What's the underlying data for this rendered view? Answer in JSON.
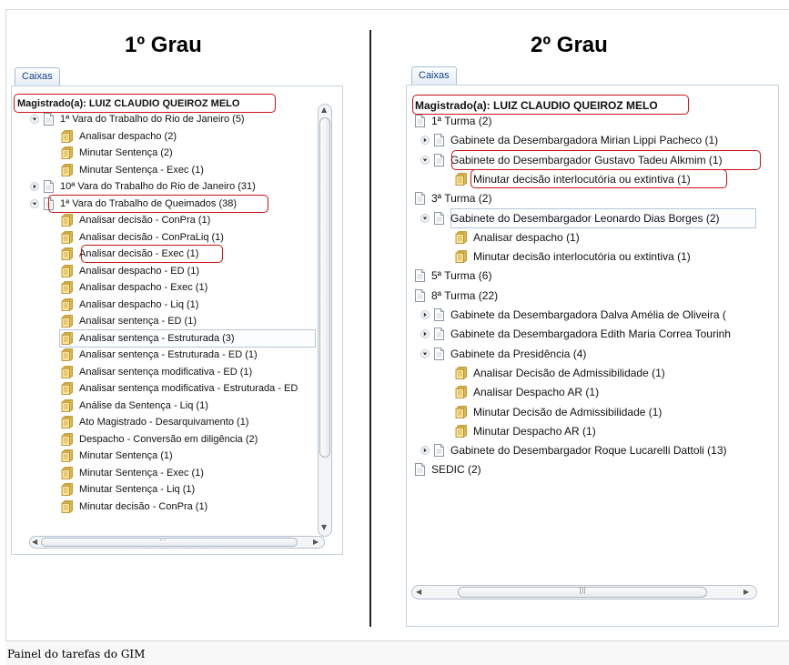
{
  "caption": "Painel do tarefas do GIM",
  "left": {
    "heading": "1º Grau",
    "tab": "Caixas",
    "magistrado": "Magistrado(a): LUIZ CLAUDIO QUEIROZ MELO",
    "nodes": [
      {
        "label": "1ª Vara do Trabalho do Rio de Janeiro (5)",
        "type": "doc",
        "toggle": "expanded"
      },
      {
        "label": "Analisar despacho (2)",
        "type": "folder"
      },
      {
        "label": "Minutar Sentença (2)",
        "type": "folder"
      },
      {
        "label": "Minutar Sentença - Exec (1)",
        "type": "folder"
      },
      {
        "label": "10ª Vara do Trabalho do Rio de Janeiro (31)",
        "type": "doc",
        "toggle": "collapsed"
      },
      {
        "label": "1ª Vara do Trabalho de Queimados (38)",
        "type": "doc",
        "toggle": "expanded"
      },
      {
        "label": "Analisar decisão - ConPra (1)",
        "type": "folder"
      },
      {
        "label": "Analisar decisão - ConPraLiq (1)",
        "type": "folder"
      },
      {
        "label": "Analisar decisão - Exec (1)",
        "type": "folder"
      },
      {
        "label": "Analisar despacho - ED (1)",
        "type": "folder"
      },
      {
        "label": "Analisar despacho - Exec (1)",
        "type": "folder"
      },
      {
        "label": "Analisar despacho - Liq (1)",
        "type": "folder"
      },
      {
        "label": "Analisar sentença - ED (1)",
        "type": "folder"
      },
      {
        "label": "Analisar sentença - Estruturada (3)",
        "type": "folder"
      },
      {
        "label": "Analisar sentença - Estruturada - ED (1)",
        "type": "folder"
      },
      {
        "label": "Analisar sentença modificativa - ED (1)",
        "type": "folder"
      },
      {
        "label": "Analisar sentença modificativa - Estruturada - ED",
        "type": "folder"
      },
      {
        "label": "Análise da Sentença - Liq (1)",
        "type": "folder"
      },
      {
        "label": "Ato Magistrado - Desarquivamento (1)",
        "type": "folder"
      },
      {
        "label": "Despacho - Conversão em diligência (2)",
        "type": "folder"
      },
      {
        "label": "Minutar Sentença (1)",
        "type": "folder"
      },
      {
        "label": "Minutar Sentença - Exec (1)",
        "type": "folder"
      },
      {
        "label": "Minutar Sentença - Liq (1)",
        "type": "folder"
      },
      {
        "label": "Minutar decisão - ConPra (1)",
        "type": "folder"
      }
    ]
  },
  "right": {
    "heading": "2º Grau",
    "tab": "Caixas",
    "magistrado": "Magistrado(a): LUIZ CLAUDIO QUEIROZ MELO",
    "nodes": [
      {
        "label": "1ª Turma (2)",
        "type": "doc",
        "toggle": "none"
      },
      {
        "label": "Gabinete da Desembargadora Mirian Lippi Pacheco (1)",
        "type": "doc",
        "toggle": "collapsed"
      },
      {
        "label": "Gabinete do Desembargador Gustavo Tadeu Alkmim (1)",
        "type": "doc",
        "toggle": "expanded"
      },
      {
        "label": "Minutar decisão interlocutória ou extintiva (1)",
        "type": "folder"
      },
      {
        "label": "3ª Turma (2)",
        "type": "doc",
        "toggle": "none"
      },
      {
        "label": "Gabinete do Desembargador Leonardo Dias Borges (2)",
        "type": "doc",
        "toggle": "expanded"
      },
      {
        "label": "Analisar despacho (1)",
        "type": "folder"
      },
      {
        "label": "Minutar decisão interlocutória ou extintiva (1)",
        "type": "folder"
      },
      {
        "label": "5ª Turma (6)",
        "type": "doc",
        "toggle": "none"
      },
      {
        "label": "8ª Turma (22)",
        "type": "doc",
        "toggle": "none"
      },
      {
        "label": "Gabinete da Desembargadora Dalva Amélia de Oliveira (",
        "type": "doc",
        "toggle": "collapsed"
      },
      {
        "label": "Gabinete da Desembargadora Edith Maria Correa Tourinh",
        "type": "doc",
        "toggle": "collapsed"
      },
      {
        "label": "Gabinete da Presidência (4)",
        "type": "doc",
        "toggle": "expanded"
      },
      {
        "label": "Analisar Decisão de Admissibilidade (1)",
        "type": "folder"
      },
      {
        "label": "Analisar Despacho AR (1)",
        "type": "folder"
      },
      {
        "label": "Minutar Decisão de Admissibilidade (1)",
        "type": "folder"
      },
      {
        "label": "Minutar Despacho AR (1)",
        "type": "folder"
      },
      {
        "label": "Gabinete do Desembargador Roque Lucarelli Dattoli (13)",
        "type": "doc",
        "toggle": "collapsed"
      },
      {
        "label": "SEDIC (2)",
        "type": "doc",
        "toggle": "none"
      }
    ]
  },
  "colors": {
    "highlight": "#c81414",
    "tab_text": "#15428b",
    "panel_border": "#c5d3e3"
  }
}
